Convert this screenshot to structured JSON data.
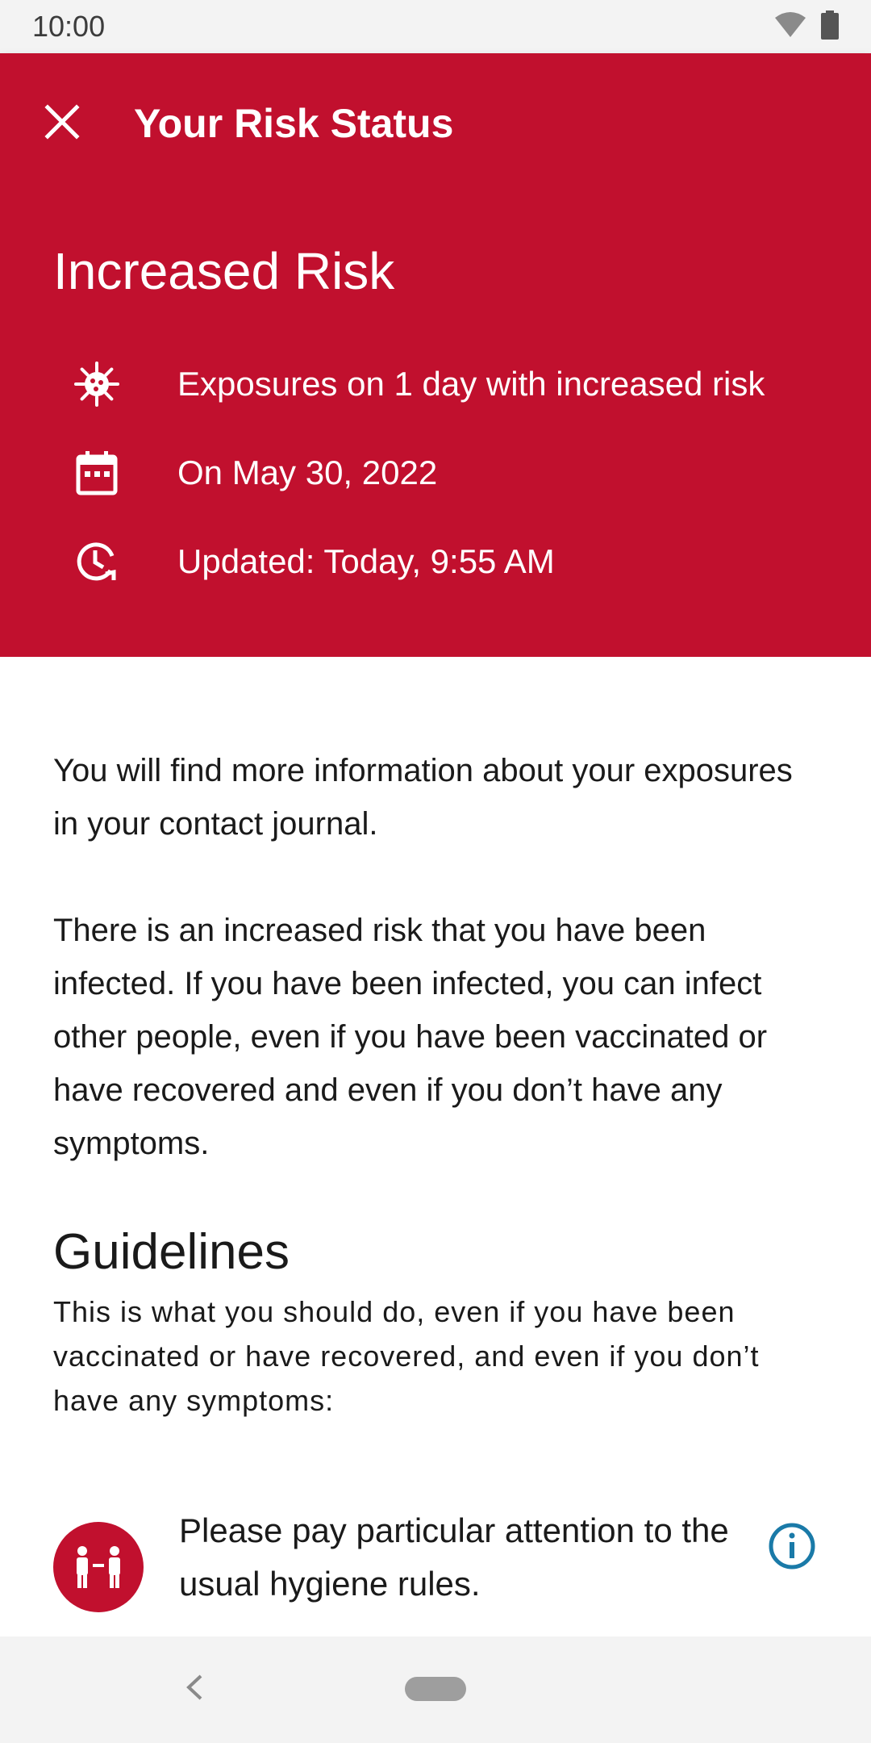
{
  "status_bar": {
    "time": "10:00",
    "icons": [
      "wifi-icon",
      "battery-icon"
    ]
  },
  "header": {
    "title": "Your Risk Status",
    "close_icon": "close-icon",
    "risk_level": "Increased Risk",
    "accent_color": "#c1102e",
    "details": [
      {
        "icon": "virus-icon",
        "text": "Exposures on 1 day with increased risk"
      },
      {
        "icon": "calendar-icon",
        "text": "On May 30, 2022"
      },
      {
        "icon": "clock-refresh-icon",
        "text": "Updated: Today, 9:55 AM"
      }
    ]
  },
  "content": {
    "paragraph1": "You will find more information about your exposures in your contact journal.",
    "paragraph2": "There is an increased risk that you have been infected. If you have been infected, you can infect other people, even if you have been vaccinated or have recovered and even if you don’t have any symptoms.",
    "guidelines_title": "Guidelines",
    "guidelines_subtitle": "This is what you should do, even if you have been vaccinated or have recovered, and even if you don’t have any symptoms:",
    "guidelines": [
      {
        "icon": "distancing-icon",
        "text": "Please pay particular attention to the usual hygiene rules.",
        "info_icon": "info-icon",
        "info_color": "#1a7aa8"
      }
    ]
  },
  "nav_bar": {
    "icons": [
      "back-icon",
      "home-pill"
    ]
  }
}
